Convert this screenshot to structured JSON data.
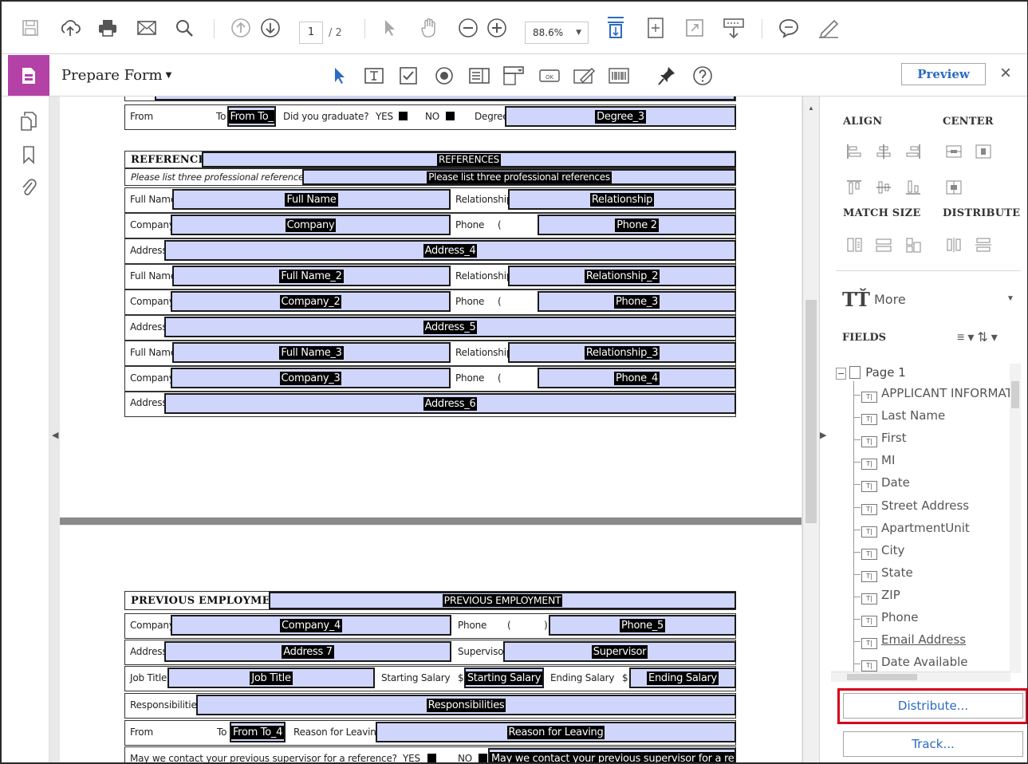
{
  "toolbar": {
    "page_current": "1",
    "page_total": "/ 2",
    "zoom": "88.6%"
  },
  "formbar": {
    "title": "Prepare Form",
    "preview_label": "Preview",
    "close_label": "×"
  },
  "document": {
    "page1": {
      "education_row": {
        "from_label": "From",
        "to_label": "To",
        "to_field": "From To_",
        "graduate_label": "Did you graduate?",
        "yes_label": "YES",
        "no_label": "NO",
        "degree_label": "Degree",
        "degree_field": "Degree_3"
      },
      "references": {
        "title": "REFERENCES",
        "title_field": "REFERENCES",
        "subtitle": "Please list three professional references",
        "subtitle_field": "Please list three professional references",
        "entries": [
          {
            "name_label": "Full Name",
            "name_field": "Full Name",
            "rel_label": "Relationship",
            "rel_field": "Relationship",
            "company_label": "Company",
            "company_field": "Company",
            "phone_label": "Phone",
            "phone_paren": "(",
            "phone_field": "Phone 2",
            "address_label": "Address",
            "address_field": "Address_4"
          },
          {
            "name_label": "Full Name",
            "name_field": "Full Name_2",
            "rel_label": "Relationship",
            "rel_field": "Relationship_2",
            "company_label": "Company",
            "company_field": "Company_2",
            "phone_label": "Phone",
            "phone_paren": "(",
            "phone_field": "Phone_3",
            "address_label": "Address",
            "address_field": "Address_5"
          },
          {
            "name_label": "Full Name",
            "name_field": "Full Name_3",
            "rel_label": "Relationship",
            "rel_field": "Relationship_3",
            "company_label": "Company",
            "company_field": "Company_3",
            "phone_label": "Phone",
            "phone_paren": "(",
            "phone_field": "Phone_4",
            "address_label": "Address",
            "address_field": "Address_6"
          }
        ]
      }
    },
    "page2": {
      "title": "PREVIOUS EMPLOYMENT",
      "title_field": "PREVIOUS EMPLOYMENT",
      "company_label": "Company",
      "company_field": "Company_4",
      "phone_label": "Phone",
      "phone_paren_open": "(",
      "phone_paren_close": ")",
      "phone_field": "Phone_5",
      "address_label": "Address",
      "address_field": "Address 7",
      "supervisor_label": "Supervisor",
      "supervisor_field": "Supervisor",
      "job_label": "Job Title",
      "job_field": "Job Title",
      "start_salary_label": "Starting Salary",
      "dollar": "$",
      "start_salary_field": "Starting Salary",
      "end_salary_label": "Ending Salary",
      "end_salary_field": "Ending Salary",
      "resp_label": "Responsibilities",
      "resp_field": "Responsibilities",
      "from_label": "From",
      "to_label": "To",
      "to_field": "From To_4",
      "reason_label": "Reason for Leaving",
      "reason_field": "Reason for Leaving",
      "contact_label": "May we contact your previous supervisor for a reference?",
      "yes_label": "YES",
      "no_label": "NO",
      "contact_field": "May we contact your previous supervisor for a refer"
    }
  },
  "rightpanel": {
    "align_title": "ALIGN",
    "center_title": "CENTER",
    "match_title": "MATCH SIZE",
    "distribute_title": "DISTRIBUTE",
    "more_icon_text": "TŤ",
    "more_label": "More",
    "fields_title": "FIELDS",
    "tree_page": "Page 1",
    "tree_items": [
      "APPLICANT INFORMAT",
      "Last Name",
      "First",
      "MI",
      "Date",
      "Street Address",
      "ApartmentUnit",
      "City",
      "State",
      "ZIP",
      "Phone",
      "Email Address",
      "Date Available"
    ],
    "distribute_btn": "Distribute...",
    "track_btn": "Track..."
  }
}
